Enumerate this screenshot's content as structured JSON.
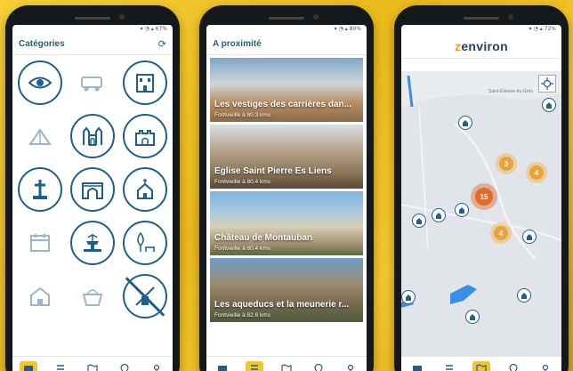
{
  "colors": {
    "primary": "#1f5f8b",
    "accent": "#e7a12a",
    "background": "#f1c62c",
    "cluster_outer": "#f3b55b",
    "cluster_inner": "#e8a33a",
    "cluster_big": "#e06c2c"
  },
  "phone1": {
    "status": "67%",
    "title": "Catégories",
    "refresh_icon": "refresh-icon",
    "categories": [
      {
        "icon": "eye-icon",
        "muted": false
      },
      {
        "icon": "camper-van-icon",
        "muted": true
      },
      {
        "icon": "building-icon",
        "muted": false
      },
      {
        "icon": "camping-tent-icon",
        "muted": true
      },
      {
        "icon": "cathedral-icon",
        "muted": false
      },
      {
        "icon": "castle-icon",
        "muted": false
      },
      {
        "icon": "cross-monument-icon",
        "muted": false
      },
      {
        "icon": "arch-gate-icon",
        "muted": false
      },
      {
        "icon": "chapel-icon",
        "muted": false
      },
      {
        "icon": "calendar-icon",
        "muted": true
      },
      {
        "icon": "fountain-icon",
        "muted": false
      },
      {
        "icon": "tree-bench-icon",
        "muted": false
      },
      {
        "icon": "house-icon",
        "muted": true
      },
      {
        "icon": "basket-icon",
        "muted": true
      },
      {
        "icon": "windmill-icon",
        "muted": false
      }
    ]
  },
  "phone2": {
    "status": "80%",
    "title": "A proximité",
    "places": [
      {
        "name": "Les vestiges des carrières dan...",
        "distance": "Fontvieille à   80.3 kms"
      },
      {
        "name": "Eglise Saint Pierre Es Liens",
        "distance": "Fontvieille à   80.4 kms"
      },
      {
        "name": "Château de Montauban",
        "distance": "Fontvieille à   80.4 kms"
      },
      {
        "name": "Les aqueducs et la meunerie r...",
        "distance": "Fontvieille à   82.6 kms"
      }
    ]
  },
  "phone3": {
    "status": "72%",
    "logo": "zenviron",
    "map_labels": [
      "Saint-Étienne-du-Grès"
    ],
    "clusters": [
      "3",
      "4",
      "15",
      "4"
    ]
  },
  "nav": {
    "items": [
      "map-book-icon",
      "list-icon",
      "map-icon",
      "pin-icon",
      "user-icon"
    ]
  }
}
